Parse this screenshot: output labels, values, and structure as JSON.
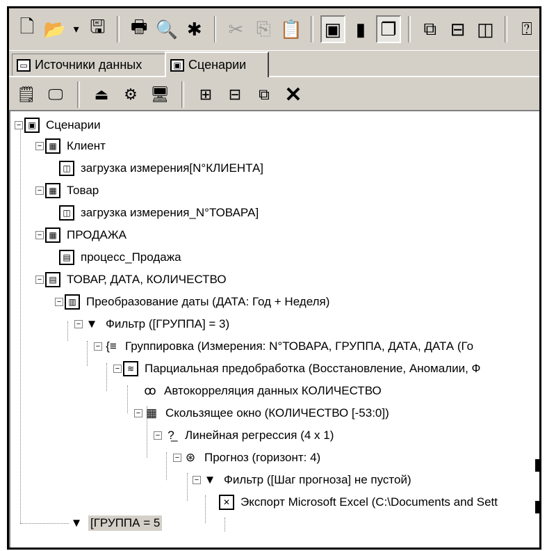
{
  "toolbar": {
    "icons": [
      "new-document-icon",
      "open-folder-icon",
      "dropdown-arrow-icon",
      "save-icon",
      "print-icon",
      "print-preview-icon",
      "wizard-icon",
      "cut-icon",
      "copy-icon",
      "paste-icon",
      "scenarios-icon",
      "datasource-icon",
      "windows-icon",
      "cascade-icon",
      "horizontal-split-icon",
      "vertical-split-icon",
      "help-icon"
    ]
  },
  "tabs": [
    {
      "label": "Источники данных",
      "icon": "datasource-tab-icon",
      "active": false
    },
    {
      "label": "Сценарии",
      "icon": "scenarios-tab-icon",
      "active": true
    }
  ],
  "actions": [
    "properties-icon",
    "report-icon",
    "import-icon",
    "processor-icon",
    "visualize-icon",
    "tree-expand-icon",
    "tree-collapse-icon",
    "tree-copy-icon",
    "delete-icon"
  ],
  "tree": [
    {
      "label": "Сценарии",
      "icon": "scenarios-root-icon"
    },
    {
      "label": "Клиент",
      "icon": "table-icon"
    },
    {
      "label": "загрузка измерения[N°КЛИЕНТА]",
      "icon": "cube-load-icon"
    },
    {
      "label": "Товар",
      "icon": "table-icon"
    },
    {
      "label": "загрузка измерения_N°ТОВАРА]",
      "icon": "cube-load-icon"
    },
    {
      "label": "ПРОДАЖА",
      "icon": "table-icon"
    },
    {
      "label": "процесс_Продажа",
      "icon": "process-icon"
    },
    {
      "label": "ТОВАР, ДАТА, КОЛИЧЕСТВО",
      "icon": "process-icon"
    },
    {
      "label": "Преобразование даты (ДАТА: Год + Неделя)",
      "icon": "date-transform-icon"
    },
    {
      "label": "Фильтр ([ГРУППА] = 3)",
      "icon": "filter-icon"
    },
    {
      "label": "Группировка (Измерения: N°ТОВАРА, ГРУППА, ДАТА, ДАТА (Го",
      "icon": "grouping-icon"
    },
    {
      "label": "Парциальная предобработка (Восстановление, Аномалии, Ф",
      "icon": "preprocessing-icon"
    },
    {
      "label": "Автокорреляция данных КОЛИЧЕСТВО",
      "icon": "autocorrelation-icon"
    },
    {
      "label": "Скользящее окно (КОЛИЧЕСТВО [-53:0])",
      "icon": "sliding-window-icon"
    },
    {
      "label": "Линейная регрессия (4 x 1)",
      "icon": "regression-icon"
    },
    {
      "label": "Прогноз (горизонт: 4)",
      "icon": "forecast-icon"
    },
    {
      "label": "Фильтр ([Шаг прогноза] не пустой)",
      "icon": "filter-icon"
    },
    {
      "label": "Экспорт Microsoft Excel (C:\\Documents and Sett",
      "icon": "excel-export-icon"
    },
    {
      "label": "[ГРУППА = 5",
      "icon": "filter-icon"
    }
  ]
}
